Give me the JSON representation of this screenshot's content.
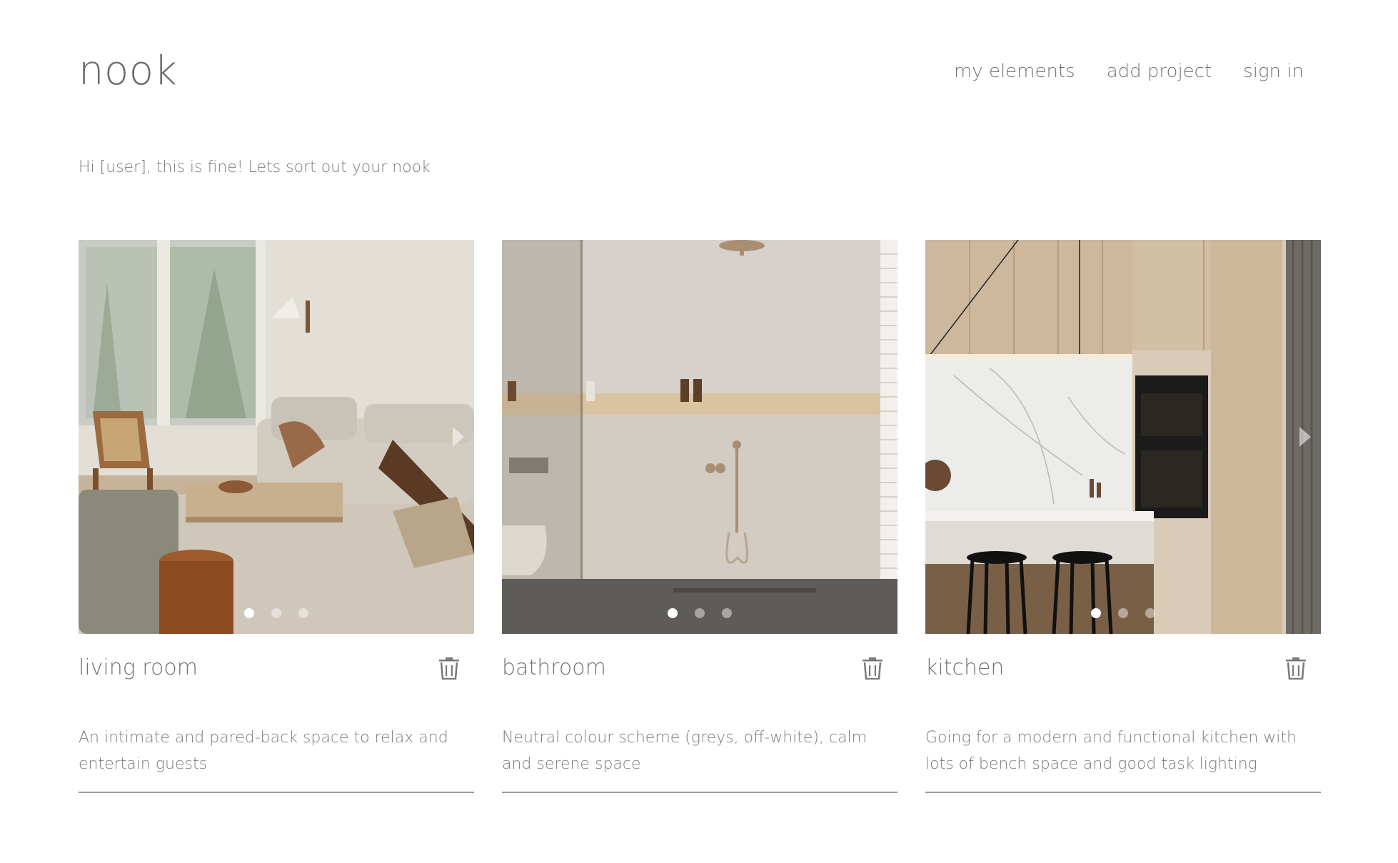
{
  "header": {
    "logo": "nook",
    "nav": [
      "my elements",
      "add project",
      "sign in"
    ]
  },
  "greeting": "Hi [user], this is fine! Lets sort out your nook",
  "projects": [
    {
      "title": "living room",
      "description": "An intimate and pared-back space to relax and entertain guests",
      "image_subject": "living-room-photo",
      "dots": 3,
      "active_dot": 1
    },
    {
      "title": "bathroom",
      "description": "Neutral colour scheme (greys, off-white), calm and serene space",
      "image_subject": "bathroom-photo",
      "dots": 3,
      "active_dot": 1
    },
    {
      "title": "kitchen",
      "description": "Going for a modern and functional kitchen with lots of bench space and good task lighting",
      "image_subject": "kitchen-photo",
      "dots": 3,
      "active_dot": 1
    }
  ],
  "icons": {
    "delete": "trash-icon",
    "next": "chevron-right-icon"
  },
  "colors": {
    "text": "#737373",
    "rule": "#9a9a9a",
    "background": "#ffffff"
  }
}
